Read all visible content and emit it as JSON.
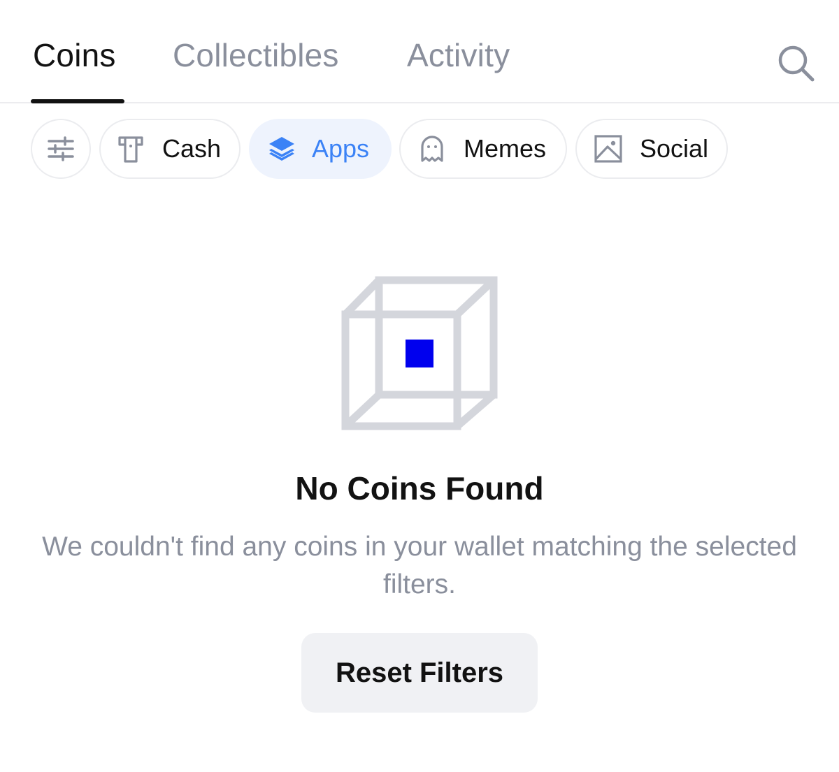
{
  "tabs": [
    {
      "label": "Coins",
      "active": true
    },
    {
      "label": "Collectibles",
      "active": false
    },
    {
      "label": "Activity",
      "active": false
    }
  ],
  "search": {
    "icon": "search-icon"
  },
  "filters": {
    "settings_icon": "sliders-icon",
    "chips": [
      {
        "label": "Cash",
        "icon": "cash-icon",
        "selected": false
      },
      {
        "label": "Apps",
        "icon": "layers-icon",
        "selected": true
      },
      {
        "label": "Memes",
        "icon": "ghost-icon",
        "selected": false
      },
      {
        "label": "Social",
        "icon": "image-icon",
        "selected": false
      }
    ]
  },
  "empty_state": {
    "illustration": "cube-icon",
    "title": "No Coins Found",
    "description": "We couldn't find any coins in your wallet matching the selected filters.",
    "reset_label": "Reset Filters"
  },
  "colors": {
    "accent": "#3b82f6",
    "accent_bg": "#eef3fd",
    "text_primary": "#121212",
    "text_secondary": "#8a8f9c",
    "illustration_stroke": "#d4d6dc",
    "illustration_core": "#0000ee"
  }
}
